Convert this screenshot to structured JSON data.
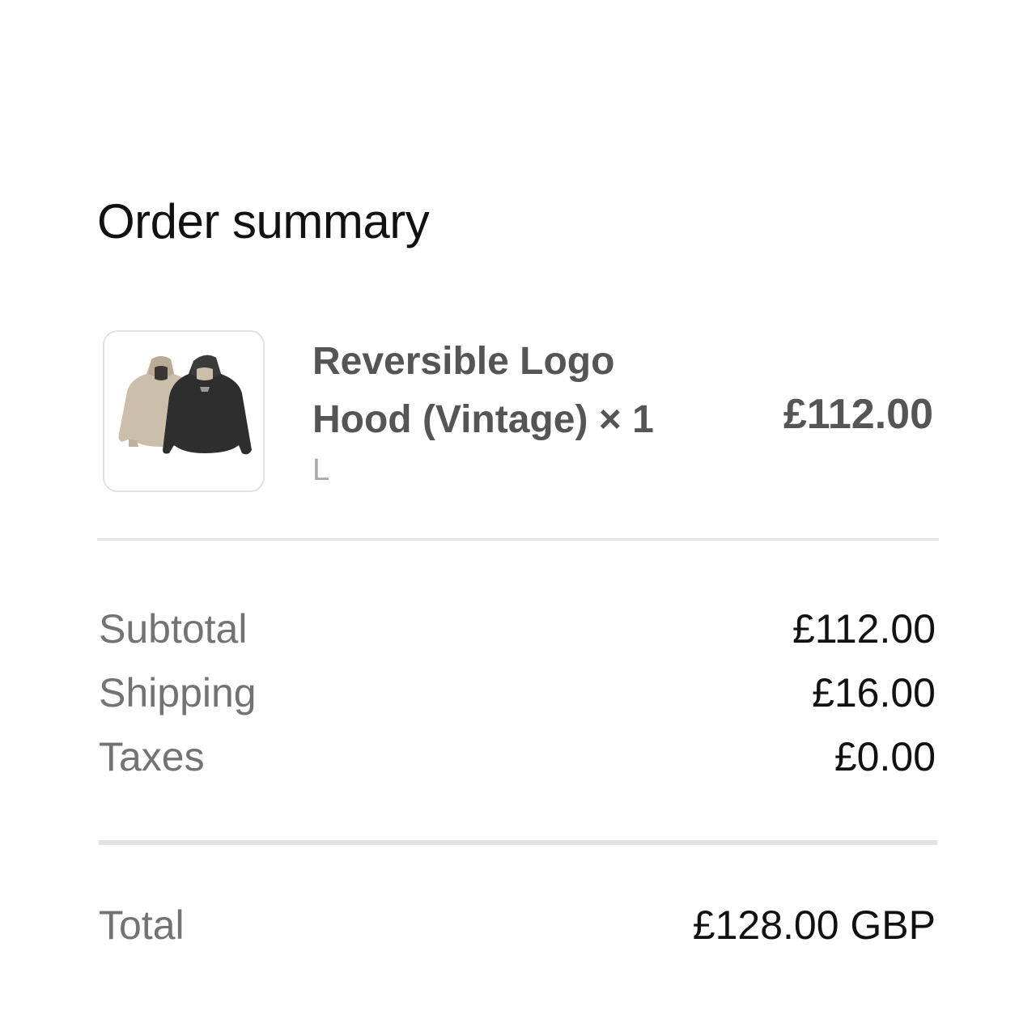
{
  "order_summary": {
    "title": "Order summary",
    "item": {
      "name": "Reversible Logo Hood (Vintage) × 1",
      "variant": "L",
      "price": "£112.00",
      "thumbnail": "two-hoodies-product-image"
    },
    "subtotal": {
      "label": "Subtotal",
      "value": "£112.00"
    },
    "shipping": {
      "label": "Shipping",
      "value": "£16.00"
    },
    "taxes": {
      "label": "Taxes",
      "value": "£0.00"
    },
    "total": {
      "label": "Total",
      "value": "£128.00 GBP"
    }
  },
  "colors": {
    "heading": "#111111",
    "muted_label": "#737373",
    "product_text": "#555555",
    "variant_text": "#a9a9a9",
    "divider": "#e3e3e3",
    "hood_beige": "#c9bca8",
    "hood_charcoal": "#2c2c2c"
  }
}
